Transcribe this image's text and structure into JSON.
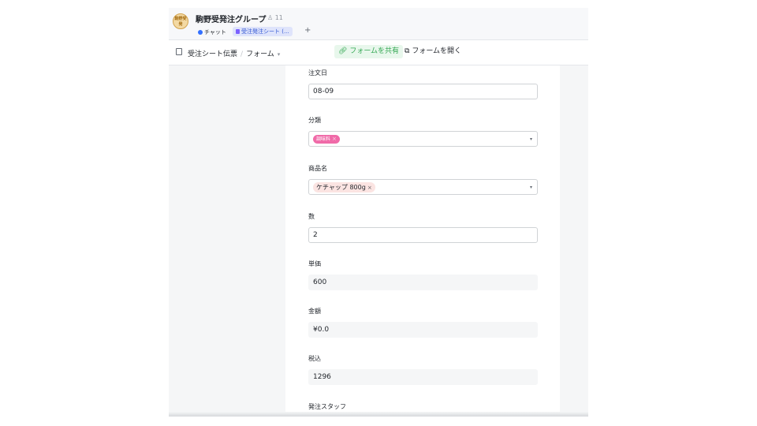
{
  "header": {
    "avatar_text": "駒野受発",
    "group_title": "駒野受発注グループ",
    "member_count": "11",
    "tabs": [
      {
        "label": "チャット"
      },
      {
        "label": "受注発注シート (..."
      }
    ],
    "add_tab": "+"
  },
  "toolbar": {
    "breadcrumb_sheet": "受注シート伝票",
    "breadcrumb_sep": "/",
    "breadcrumb_view": "フォーム",
    "view_caret": "▾",
    "share_label": "フォームを共有",
    "open_label": "フォームを開く"
  },
  "form": {
    "order_date": {
      "label": "注文日",
      "value": "08-09"
    },
    "category": {
      "label": "分類",
      "tag": "調味料",
      "tag_remove": "×"
    },
    "product": {
      "label": "商品名",
      "tag": "ケチャップ 800g",
      "tag_remove": "×"
    },
    "quantity": {
      "label": "数",
      "value": "2"
    },
    "unit_price": {
      "label": "単価",
      "value": "600"
    },
    "amount": {
      "label": "金額",
      "value": "¥0.0"
    },
    "tax_included": {
      "label": "税込",
      "value": "1296"
    },
    "staff": {
      "label": "発注スタッフ"
    },
    "select_caret": "▾"
  },
  "colors": {
    "share_green": "#34a853",
    "tag_pink": "#f06aa8",
    "tab_blue": "#3358d4"
  }
}
